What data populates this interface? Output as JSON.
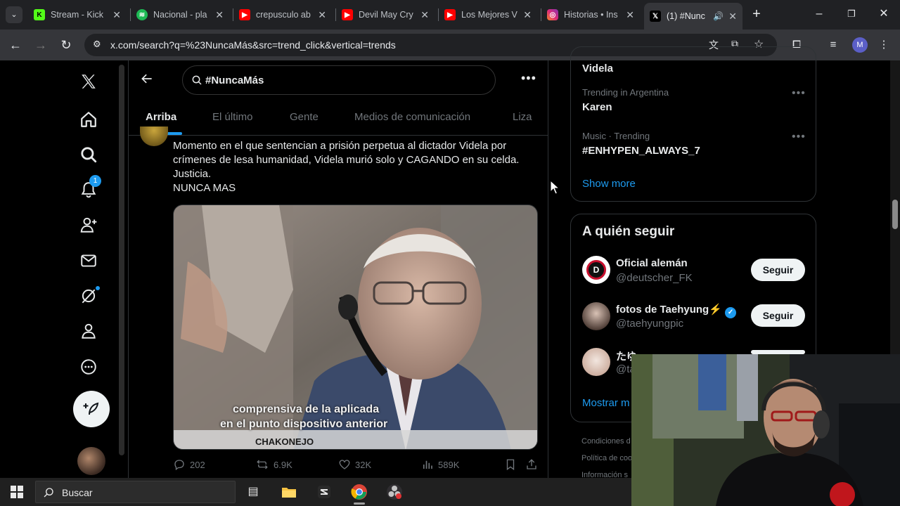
{
  "browser": {
    "tabs": [
      {
        "title": "Stream - Kick",
        "icon": "kick-icon",
        "color": "#53fc18"
      },
      {
        "title": "Nacional - pla",
        "icon": "spotify-icon",
        "color": "#1db954"
      },
      {
        "title": "crepusculo ab",
        "icon": "youtube-icon",
        "color": "#ff0000"
      },
      {
        "title": "Devil May Cry",
        "icon": "youtube-icon",
        "color": "#ff0000"
      },
      {
        "title": "Los Mejores V",
        "icon": "youtube-icon",
        "color": "#ff0000"
      },
      {
        "title": "Historias • Ins",
        "icon": "instagram-icon",
        "color": "#e1306c"
      },
      {
        "title": "(1) #Nunc",
        "icon": "x-icon",
        "color": "#000000"
      }
    ],
    "url": "x.com/search?q=%23NuncaMás&src=trend_click&vertical=trends",
    "profile_initial": "M"
  },
  "search": {
    "query": "#NuncaMás"
  },
  "filter_tabs": [
    "Arriba",
    "El último",
    "Gente",
    "Medios de comunicación",
    "Liza"
  ],
  "tweet": {
    "lines": [
      "Momento en el que sentencian a prisión perpetua al dictador Videla por",
      "crímenes de lesa humanidad, Videla murió solo y CAGANDO en su celda.",
      "Justicia.",
      "NUNCA MAS"
    ],
    "video_caption_1": "comprensiva de la aplicada",
    "video_caption_2": "en el punto dispositivo anterior",
    "video_watermark": "CHAKONEJO",
    "replies": "202",
    "reposts": "6.9K",
    "likes": "32K",
    "views": "589K"
  },
  "sidebar": {
    "notification_count": "1"
  },
  "trends": {
    "partial_top": "Videla",
    "items": [
      {
        "context": "Trending in Argentina",
        "name": "Karen"
      },
      {
        "context": "Music · Trending",
        "name": "#ENHYPEN_ALWAYS_7"
      }
    ],
    "show_more": "Show more"
  },
  "who_to_follow": {
    "title": "A quién seguir",
    "users": [
      {
        "name": "Oficial alemán",
        "handle": "@deutscher_FK",
        "button": "Seguir"
      },
      {
        "name": "fotos de Taehyung⚡",
        "handle": "@taehyungpic",
        "button": "Seguir"
      },
      {
        "name": "たゆ",
        "handle": "@ta",
        "button": ""
      }
    ],
    "show_more": "Mostrar m"
  },
  "footer": {
    "links": [
      "Condiciones d",
      "Política de coo",
      "Información s"
    ]
  },
  "taskbar": {
    "search_label": "Buscar"
  },
  "colors": {
    "accent": "#1d9bf0",
    "background": "#000000",
    "text_primary": "#e7e9ea",
    "text_secondary": "#71767b"
  }
}
